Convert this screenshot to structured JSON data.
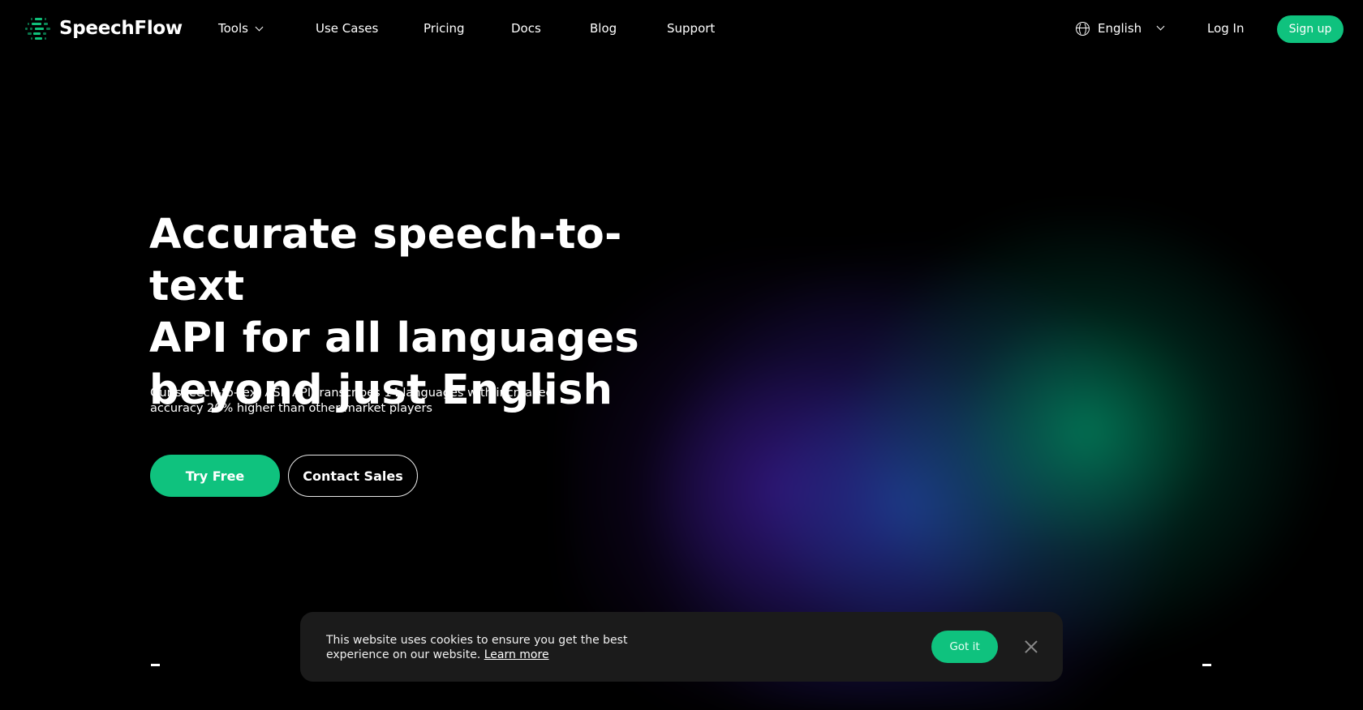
{
  "brand": {
    "name": "SpeechFlow",
    "accent": "#0fc27e"
  },
  "nav": {
    "items": [
      {
        "label": "Tools",
        "has_dropdown": true
      },
      {
        "label": "Use Cases"
      },
      {
        "label": "Pricing"
      },
      {
        "label": "Docs"
      },
      {
        "label": "Blog"
      },
      {
        "label": "Support"
      }
    ],
    "language": {
      "icon": "globe-icon",
      "label": "English"
    },
    "login_label": "Log In",
    "signup_label": "Sign up"
  },
  "hero": {
    "title_lines": [
      "Accurate speech-to-text",
      "API for all languages",
      "beyond just English"
    ],
    "subtitle": "Our speech-to-text ASR API transcribes 14 languages with increased accuracy 20% higher than other market players",
    "primary_cta": "Try Free",
    "secondary_cta": "Contact Sales"
  },
  "cookie_banner": {
    "text": "This website uses cookies to ensure you get the best experience on our website.",
    "link_label": "Learn more",
    "accept_label": "Got it",
    "close_icon": "close-icon"
  }
}
